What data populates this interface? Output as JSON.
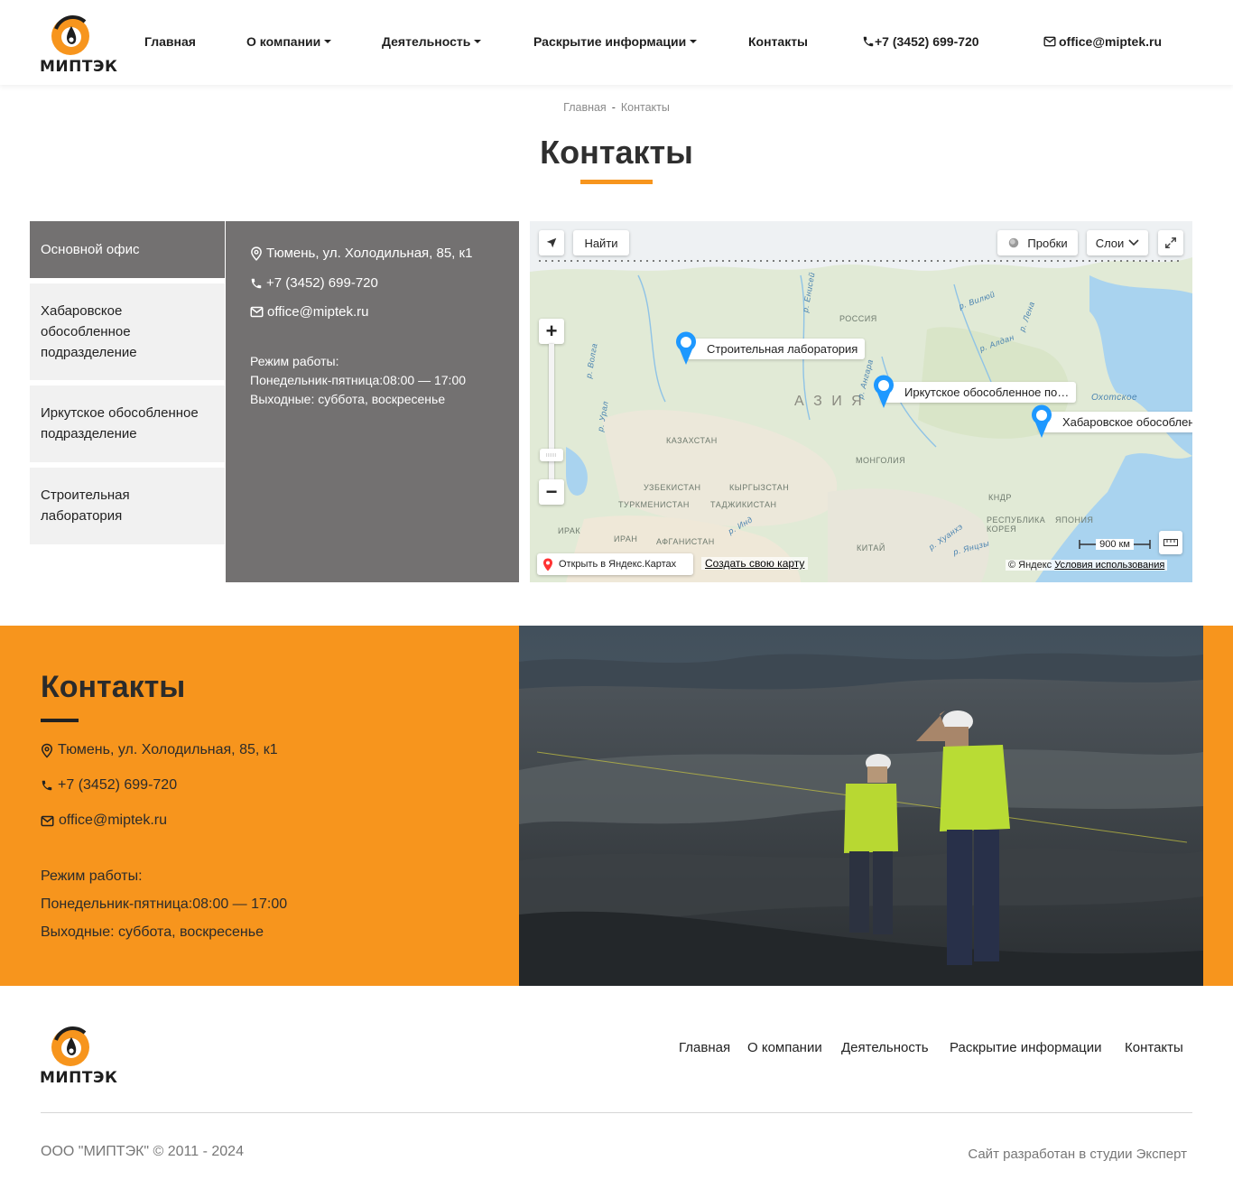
{
  "header": {
    "logo_text": "МИПТЭК",
    "nav": [
      {
        "label": "Главная"
      },
      {
        "label": "О компании"
      },
      {
        "label": "Деятельность"
      },
      {
        "label": "Раскрытие информации"
      },
      {
        "label": "Контакты"
      }
    ],
    "phone": "+7 (3452) 699-720",
    "email": "office@miptek.ru"
  },
  "breadcrumb": {
    "home": "Главная",
    "sep": "-",
    "current": "Контакты"
  },
  "page_title": "Контакты",
  "offices": {
    "tabs": [
      {
        "label": "Основной офис",
        "active": true
      },
      {
        "label": "Хабаровское обособленное подразделение",
        "active": false
      },
      {
        "label": "Иркутское обособленное подразделение",
        "active": false
      },
      {
        "label": "Строительная лаборатория",
        "active": false
      }
    ],
    "active": {
      "address": "Тюмень, ул. Холодильная, 85, к1",
      "phone": "+7 (3452) 699-720",
      "email": "office@miptek.ru",
      "hours_title": "Режим работы:",
      "hours_weekdays": "Понедельник-пятница:08:00 — 17:00",
      "hours_weekend": "Выходные: суббота, воскресенье"
    }
  },
  "map": {
    "find_button": "Найти",
    "traffic_button": "Пробки",
    "layers_button": "Слои",
    "zoom_in": "+",
    "zoom_out": "−",
    "scale": "900 км",
    "open_in_yandex": "Открыть в Яндекс.Картах",
    "create_map": "Создать свою карту",
    "copyright": "© Яндекс",
    "terms": "Условия использования",
    "placemarks": [
      {
        "label": "Строительная лаборатория"
      },
      {
        "label": "Иркутское обособленное по…"
      },
      {
        "label": "Хабаровское обособленн"
      }
    ],
    "labels": {
      "asia": "А З И Я",
      "russia": "РОССИЯ",
      "kazakhstan": "КАЗАХСТАН",
      "mongolia": "МОНГОЛИЯ",
      "uzbekistan": "УЗБЕКИСТАН",
      "kyrgyzstan": "КЫРГЫЗСТАН",
      "turkmenistan": "ТУРКМЕНИСТАН",
      "tajikistan": "ТАДЖИКИСТАН",
      "iran": "ИРАН",
      "iraq": "ИРАК",
      "afghanistan": "АФГАНИСТАН",
      "china": "КИТАЙ",
      "japan": "ЯПОНИЯ",
      "korea": "РЕСПУБЛИКА КОРЕЯ",
      "dprk": "КНДР",
      "okhotsk": "Охотское",
      "r_ural": "р. Урал",
      "r_volga": "р. Волга",
      "r_lena": "р. Лена",
      "r_vilyuy": "р. Вилюй",
      "r_aldan": "р. Алдан",
      "r_angara": "р. Ангара",
      "r_yenisei": "р. Енисей",
      "r_ind": "р. Инд",
      "r_huanghe": "р. Хуанхэ",
      "r_yangtze": "р. Янцзы"
    }
  },
  "contacts_band": {
    "title": "Контакты",
    "address": "Тюмень, ул. Холодильная, 85, к1",
    "phone": "+7 (3452) 699-720",
    "email": "office@miptek.ru",
    "hours_title": "Режим работы:",
    "hours_weekdays": "Понедельник-пятница:08:00 — 17:00",
    "hours_weekend": "Выходные: суббота, воскресенье"
  },
  "footer": {
    "logo_text": "МИПТЭК",
    "nav": [
      {
        "label": "Главная"
      },
      {
        "label": "О компании"
      },
      {
        "label": "Деятельность"
      },
      {
        "label": "Раскрытие информации"
      },
      {
        "label": "Контакты"
      }
    ],
    "copyright": "ООО \"МИПТЭК\" © 2011 - 2024",
    "developer": "Сайт разработан в студии Эксперт"
  },
  "colors": {
    "accent": "#f7951d",
    "panel_gray": "#737171",
    "tab_gray": "#f1f1f1"
  }
}
